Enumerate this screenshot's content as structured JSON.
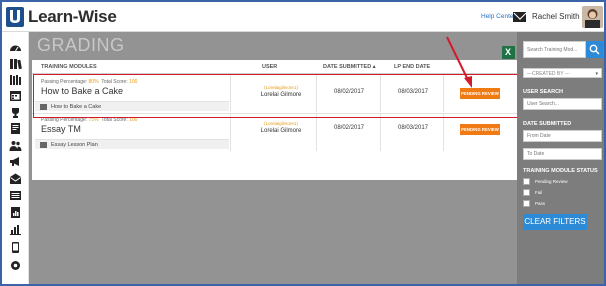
{
  "app": {
    "logo_text": "Learn-Wise",
    "help_link": "Help Center",
    "user_name": "Rachel Smith"
  },
  "page": {
    "title": "GRADING"
  },
  "table": {
    "columns": [
      "TRAINING MODULES",
      "USER",
      "DATE SUBMITTED ▴",
      "LP END DATE"
    ],
    "rows": [
      {
        "passing_label": "Passing Percentage:",
        "passing_value": "80%",
        "score_label": "Total Score:",
        "score_value": "100",
        "module_name": "How to Bake a Cake",
        "lesson": "How to Bake a Cake",
        "user_tag": "(Lorelaigilmore1)",
        "user_full": "Lorelai Gilmore",
        "date_submitted": "08/02/2017",
        "lp_end_date": "08/03/2017",
        "action": "PENDING REVIEW"
      },
      {
        "passing_label": "Passing Percentage:",
        "passing_value": "75%",
        "score_label": "Total Score:",
        "score_value": "100",
        "module_name": "Essay TM",
        "lesson": "Essay Lesson Plan",
        "user_tag": "(Lorelaigilmore1)",
        "user_full": "Lorelai Gilmore",
        "date_submitted": "08/02/2017",
        "lp_end_date": "08/03/2017",
        "action": "PENDING REVIEW"
      }
    ]
  },
  "filters": {
    "search_placeholder": "Search Training Mod...",
    "created_by": "---CREATED BY ---",
    "user_search_label": "USER SEARCH",
    "user_search_placeholder": "User Search...",
    "date_submitted_label": "DATE SUBMITTED",
    "from_date_placeholder": "From Date",
    "to_date_placeholder": "To Date",
    "status_label": "TRAINING MODULE STATUS",
    "status_options": [
      "Pending Review",
      "Fail",
      "Pass"
    ],
    "clear_label": "CLEAR FILTERS"
  },
  "colors": {
    "accent_blue": "#2d8ad6",
    "pending_orange": "#f07a14",
    "highlight_red": "#d11c2c",
    "brand_navy": "#1c4f8c"
  },
  "icons": {
    "left_rail": [
      "dashboard-icon",
      "books-icon",
      "library-icon",
      "calendar-icon",
      "trophy-icon",
      "document-icon",
      "users-icon",
      "megaphone-icon",
      "mail-icon",
      "list-icon",
      "report-icon",
      "chart-icon",
      "tablet-icon",
      "settings-icon"
    ]
  }
}
